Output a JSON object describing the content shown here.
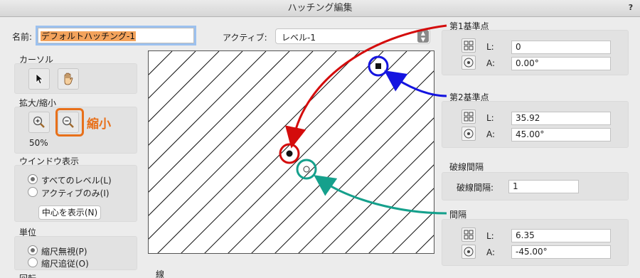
{
  "window": {
    "title": "ハッチング編集",
    "help": "?"
  },
  "name": {
    "label": "名前:",
    "value": "デフォルトハッチング-1"
  },
  "active": {
    "label": "アクティブ:",
    "selected": "レベル-1"
  },
  "cursor": {
    "label": "カーソル"
  },
  "zoom": {
    "label": "拡大/縮小",
    "value": "50%",
    "annotation": "縮小"
  },
  "window_display": {
    "label": "ウインドウ表示",
    "options": [
      "すべてのレベル(L)",
      "アクティブのみ(I)"
    ],
    "selected": 0,
    "center_button": "中心を表示(N)"
  },
  "units": {
    "label": "単位",
    "options": [
      "縮尺無視(P)",
      "縮尺追従(O)"
    ],
    "selected": 0
  },
  "bottom_labels": {
    "partial": "回転",
    "line": "線"
  },
  "ref1": {
    "label": "第1基準点",
    "L_label": "L:",
    "L": "0",
    "A_label": "A:",
    "A": "0.00°"
  },
  "ref2": {
    "label": "第2基準点",
    "L_label": "L:",
    "L": "35.92",
    "A_label": "A:",
    "A": "45.00°"
  },
  "dash": {
    "label": "破線間隔",
    "field_label": "破線間隔:",
    "value": "1"
  },
  "spacing": {
    "label": "間隔",
    "L_label": "L:",
    "L": "6.35",
    "A_label": "A:",
    "A": "-45.00°"
  },
  "colors": {
    "red": "#d40c0c",
    "blue": "#1414e0",
    "teal": "#15a08c",
    "orange": "#e8701a",
    "focus": "#9cc1ef",
    "highlight": "#f3a35c"
  }
}
